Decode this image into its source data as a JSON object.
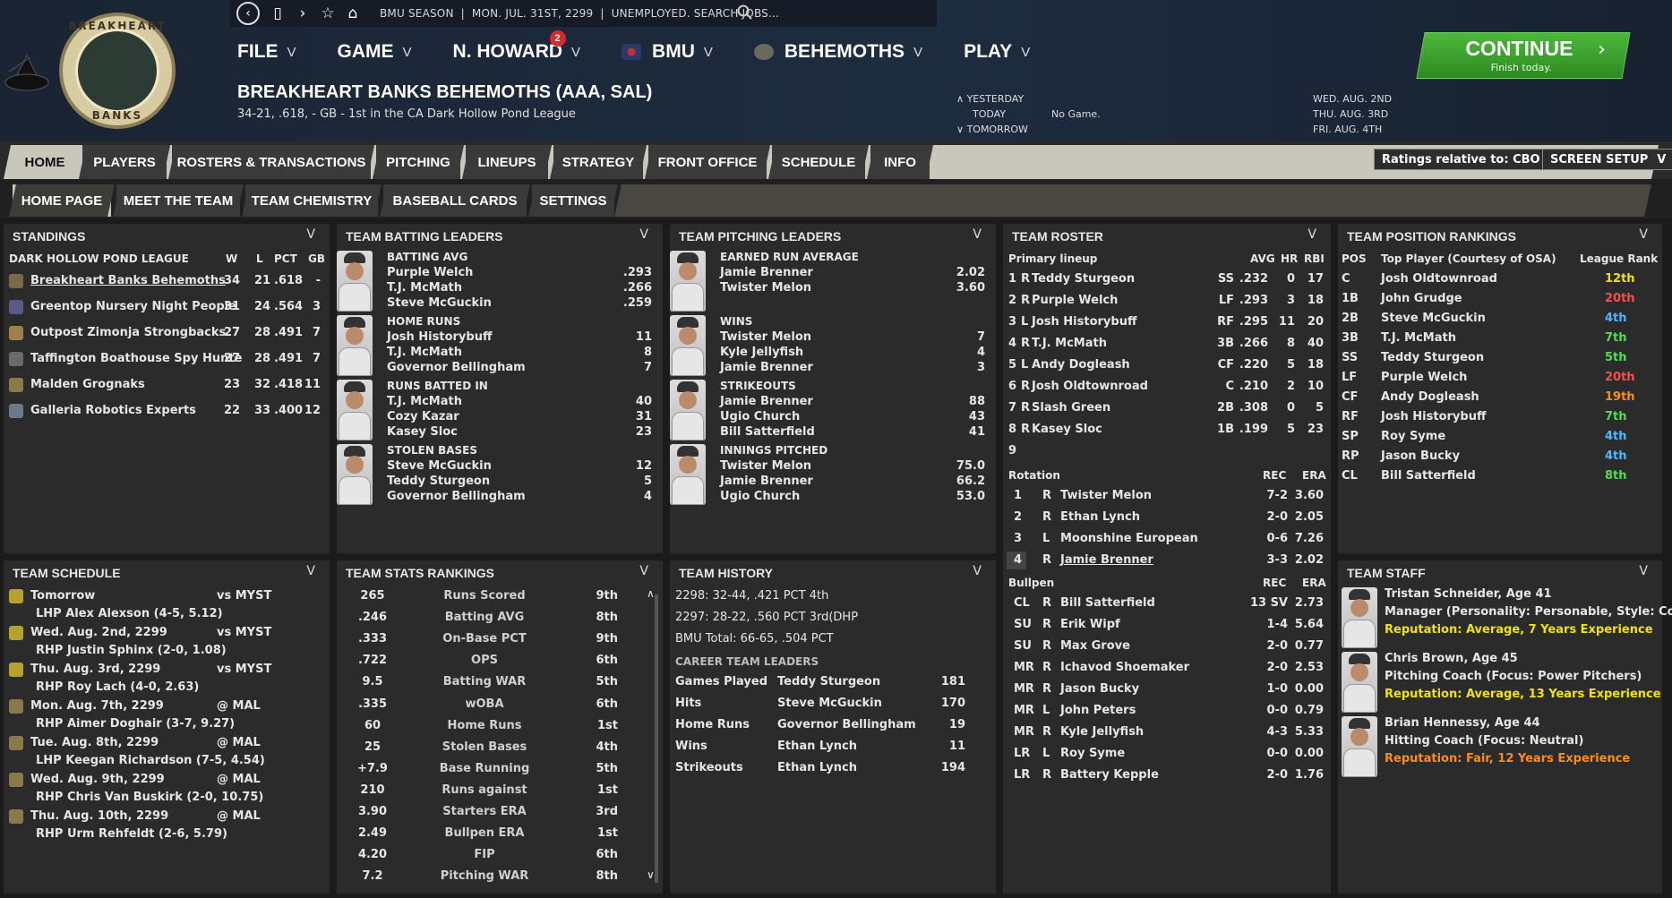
{
  "topbar": {
    "crumb": [
      "BMU SEASON",
      "|",
      "MON. JUL. 31ST, 2299",
      "|",
      "UNEMPLOYED. SEARCH JOBS..."
    ]
  },
  "logo": {
    "text_top": "BREAKHEART",
    "text_bottom": "BANKS"
  },
  "menu": [
    {
      "label": "FILE"
    },
    {
      "label": "GAME"
    },
    {
      "label": "N. HOWARD",
      "badge": "2"
    },
    {
      "label": "BMU"
    },
    {
      "label": "BEHEMOTHS"
    },
    {
      "label": "PLAY"
    }
  ],
  "team": {
    "name": "BREAKHEART BANKS BEHEMOTHS (AAA, SAL)",
    "sub": "34-21, .618, - GB - 1st in the CA Dark Hollow Pond League"
  },
  "daynav": {
    "yesterday": "YESTERDAY",
    "today": "TODAY",
    "today_note": "No Game.",
    "tomorrow": "TOMORROW",
    "dates": [
      "WED. AUG. 2ND",
      "THU. AUG. 3RD",
      "FRI. AUG. 4TH"
    ]
  },
  "continue": {
    "label": "CONTINUE",
    "sub": "Finish today."
  },
  "tabs": [
    "HOME",
    "PLAYERS",
    "ROSTERS & TRANSACTIONS",
    "PITCHING",
    "LINEUPS",
    "STRATEGY",
    "FRONT OFFICE",
    "SCHEDULE",
    "INFO"
  ],
  "subtabs": [
    "HOME PAGE",
    "MEET THE TEAM",
    "TEAM CHEMISTRY",
    "BASEBALL CARDS",
    "SETTINGS"
  ],
  "buttons": {
    "ratings": "Ratings relative to: CBO",
    "screen": "SCREEN SETUP"
  },
  "standings": {
    "title": "STANDINGS",
    "league": "DARK HOLLOW POND LEAGUE",
    "cols": [
      "W",
      "L",
      "PCT",
      "GB"
    ],
    "rows": [
      [
        "Breakheart Banks Behemoths",
        "34",
        "21",
        ".618",
        "-"
      ],
      [
        "Greentop Nursery Night People",
        "31",
        "24",
        ".564",
        "3"
      ],
      [
        "Outpost Zimonja Strongbacks",
        "27",
        "28",
        ".491",
        "7"
      ],
      [
        "Taffington Boathouse Spy Hunte",
        "27",
        "28",
        ".491",
        "7"
      ],
      [
        "Malden Grognaks",
        "23",
        "32",
        ".418",
        "11"
      ],
      [
        "Galleria Robotics Experts",
        "22",
        "33",
        ".400",
        "12"
      ]
    ]
  },
  "batting": {
    "title": "TEAM BATTING LEADERS",
    "groups": [
      {
        "cat": "BATTING AVG",
        "rows": [
          [
            "Purple Welch",
            ".293"
          ],
          [
            "T.J. McMath",
            ".266"
          ],
          [
            "Steve McGuckin",
            ".259"
          ]
        ]
      },
      {
        "cat": "HOME RUNS",
        "rows": [
          [
            "Josh Historybuff",
            "11"
          ],
          [
            "T.J. McMath",
            "8"
          ],
          [
            "Governor Bellingham",
            "7"
          ]
        ]
      },
      {
        "cat": "RUNS BATTED IN",
        "rows": [
          [
            "T.J. McMath",
            "40"
          ],
          [
            "Cozy Kazar",
            "31"
          ],
          [
            "Kasey Sloc",
            "23"
          ]
        ]
      },
      {
        "cat": "STOLEN BASES",
        "rows": [
          [
            "Steve McGuckin",
            "12"
          ],
          [
            "Teddy Sturgeon",
            "5"
          ],
          [
            "Governor Bellingham",
            "4"
          ]
        ]
      }
    ]
  },
  "pitching": {
    "title": "TEAM PITCHING LEADERS",
    "groups": [
      {
        "cat": "EARNED RUN AVERAGE",
        "rows": [
          [
            "Jamie Brenner",
            "2.02"
          ],
          [
            "Twister Melon",
            "3.60"
          ]
        ]
      },
      {
        "cat": "WINS",
        "rows": [
          [
            "Twister Melon",
            "7"
          ],
          [
            "Kyle Jellyfish",
            "4"
          ],
          [
            "Jamie Brenner",
            "3"
          ]
        ]
      },
      {
        "cat": "STRIKEOUTS",
        "rows": [
          [
            "Jamie Brenner",
            "88"
          ],
          [
            "Ugio Church",
            "43"
          ],
          [
            "Bill Satterfield",
            "41"
          ]
        ]
      },
      {
        "cat": "INNINGS PITCHED",
        "rows": [
          [
            "Twister Melon",
            "75.0"
          ],
          [
            "Jamie Brenner",
            "66.2"
          ],
          [
            "Ugio Church",
            "53.0"
          ]
        ]
      }
    ]
  },
  "roster": {
    "title": "TEAM ROSTER",
    "lineup_label": "Primary lineup",
    "cols": [
      "AVG",
      "HR",
      "RBI"
    ],
    "lineup": [
      [
        "1",
        "R",
        "Teddy Sturgeon",
        "SS",
        ".232",
        "0",
        "17"
      ],
      [
        "2",
        "R",
        "Purple Welch",
        "LF",
        ".293",
        "3",
        "18"
      ],
      [
        "3",
        "L",
        "Josh Historybuff",
        "RF",
        ".295",
        "11",
        "20"
      ],
      [
        "4",
        "R",
        "T.J. McMath",
        "3B",
        ".266",
        "8",
        "40"
      ],
      [
        "5",
        "L",
        "Andy Dogleash",
        "CF",
        ".220",
        "5",
        "18"
      ],
      [
        "6",
        "R",
        "Josh Oldtownroad",
        "C",
        ".210",
        "2",
        "10"
      ],
      [
        "7",
        "R",
        "Slash Green",
        "2B",
        ".308",
        "0",
        "5"
      ],
      [
        "8",
        "R",
        "Kasey Sloc",
        "1B",
        ".199",
        "5",
        "23"
      ],
      [
        "9",
        "",
        "",
        "",
        "",
        "",
        ""
      ]
    ],
    "rotation_label": "Rotation",
    "rec": "REC",
    "era": "ERA",
    "rotation": [
      [
        "1",
        "R",
        "Twister Melon",
        "7-2",
        "3.60"
      ],
      [
        "2",
        "R",
        "Ethan Lynch",
        "2-0",
        "2.05"
      ],
      [
        "3",
        "L",
        "Moonshine European",
        "0-6",
        "7.26"
      ],
      [
        "4",
        "R",
        "Jamie Brenner",
        "3-3",
        "2.02"
      ]
    ],
    "bullpen_label": "Bullpen",
    "bullpen": [
      [
        "CL",
        "R",
        "Bill Satterfield",
        "13 SV",
        "2.73"
      ],
      [
        "SU",
        "R",
        "Erik Wipf",
        "1-4",
        "5.64"
      ],
      [
        "SU",
        "R",
        "Max Grove",
        "2-0",
        "0.77"
      ],
      [
        "MR",
        "R",
        "Ichavod Shoemaker",
        "2-0",
        "2.53"
      ],
      [
        "MR",
        "R",
        "Jason Bucky",
        "1-0",
        "0.00"
      ],
      [
        "MR",
        "L",
        "John Peters",
        "0-0",
        "0.79"
      ],
      [
        "MR",
        "R",
        "Kyle Jellyfish",
        "4-3",
        "5.33"
      ],
      [
        "LR",
        "L",
        "Roy Syme",
        "0-0",
        "0.00"
      ],
      [
        "LR",
        "R",
        "Battery Kepple",
        "2-0",
        "1.76"
      ]
    ]
  },
  "positions": {
    "title": "TEAM POSITION RANKINGS",
    "cols": [
      "POS",
      "Top Player (Courtesy of OSA)",
      "League Rank"
    ],
    "rows": [
      [
        "C",
        "Josh Oldtownroad",
        "12th",
        "#f2e300"
      ],
      [
        "1B",
        "John Grudge",
        "20th",
        "#ff4c4c"
      ],
      [
        "2B",
        "Steve McGuckin",
        "4th",
        "#4cb7ff"
      ],
      [
        "3B",
        "T.J. McMath",
        "7th",
        "#4ee04e"
      ],
      [
        "SS",
        "Teddy Sturgeon",
        "5th",
        "#4ee04e"
      ],
      [
        "LF",
        "Purple Welch",
        "20th",
        "#ff4c4c"
      ],
      [
        "CF",
        "Andy Dogleash",
        "19th",
        "#ff8c1a"
      ],
      [
        "RF",
        "Josh Historybuff",
        "7th",
        "#4ee04e"
      ],
      [
        "SP",
        "Roy Syme",
        "4th",
        "#4cb7ff"
      ],
      [
        "RP",
        "Jason Bucky",
        "4th",
        "#4cb7ff"
      ],
      [
        "CL",
        "Bill Satterfield",
        "8th",
        "#4ee04e"
      ]
    ]
  },
  "schedule": {
    "title": "TEAM SCHEDULE",
    "rows": [
      [
        "Tomorrow",
        "vs MYST",
        "LHP Alex Alexson (4-5, 5.12)"
      ],
      [
        "Wed. Aug. 2nd, 2299",
        "vs MYST",
        "RHP Justin Sphinx (2-0, 1.08)"
      ],
      [
        "Thu. Aug. 3rd, 2299",
        "vs MYST",
        "RHP Roy Lach (4-0, 2.63)"
      ],
      [
        "Mon. Aug. 7th, 2299",
        "@ MAL",
        "RHP Aimer Doghair (3-7, 9.27)"
      ],
      [
        "Tue. Aug. 8th, 2299",
        "@ MAL",
        "LHP Keegan Richardson (7-5, 4.54)"
      ],
      [
        "Wed. Aug. 9th, 2299",
        "@ MAL",
        "RHP Chris Van Buskirk (2-0, 10.75)"
      ],
      [
        "Thu. Aug. 10th, 2299",
        "@ MAL",
        "RHP Urm Rehfeldt (2-6, 5.79)"
      ]
    ]
  },
  "stats": {
    "title": "TEAM STATS RANKINGS",
    "rows": [
      [
        "265",
        "Runs Scored",
        "9th"
      ],
      [
        ".246",
        "Batting AVG",
        "8th"
      ],
      [
        ".333",
        "On-Base PCT",
        "9th"
      ],
      [
        ".722",
        "OPS",
        "6th"
      ],
      [
        "9.5",
        "Batting WAR",
        "5th"
      ],
      [
        ".335",
        "wOBA",
        "6th"
      ],
      [
        "60",
        "Home Runs",
        "1st"
      ],
      [
        "25",
        "Stolen Bases",
        "4th"
      ],
      [
        "+7.9",
        "Base Running",
        "5th"
      ],
      [
        "210",
        "Runs against",
        "1st"
      ],
      [
        "3.90",
        "Starters ERA",
        "3rd"
      ],
      [
        "2.49",
        "Bullpen ERA",
        "1st"
      ],
      [
        "4.20",
        "FIP",
        "6th"
      ],
      [
        "7.2",
        "Pitching WAR",
        "8th"
      ]
    ]
  },
  "history": {
    "title": "TEAM HISTORY",
    "lines": [
      "2298: 32-44, .421 PCT 4th",
      "2297: 28-22, .560 PCT 3rd(DHP",
      "BMU Total: 66-65, .504 PCT"
    ],
    "career_label": "CAREER TEAM LEADERS",
    "career": [
      [
        "Games Played",
        "Teddy Sturgeon",
        "181"
      ],
      [
        "Hits",
        "Steve McGuckin",
        "170"
      ],
      [
        "Home Runs",
        "Governor Bellingham",
        "19"
      ],
      [
        "Wins",
        "Ethan Lynch",
        "11"
      ],
      [
        "Strikeouts",
        "Ethan Lynch",
        "194"
      ]
    ]
  },
  "staff": {
    "title": "TEAM STAFF",
    "rows": [
      {
        "name": "Tristan Schneider, Age 41",
        "role": "Manager (Personality: Personable, Style: Conventi",
        "rep": "Reputation: Average, 7 Years Experience",
        "rep_color": "#f2e300"
      },
      {
        "name": "Chris Brown, Age 45",
        "role": "Pitching Coach (Focus: Power Pitchers)",
        "rep": "Reputation: Average, 13 Years Experience",
        "rep_color": "#f2e300"
      },
      {
        "name": "Brian Hennessy, Age 44",
        "role": "Hitting Coach (Focus: Neutral)",
        "rep": "Reputation: Fair, 12 Years Experience",
        "rep_color": "#ff8c1a"
      }
    ]
  },
  "colors": {
    "accent_green": "#3aa52c",
    "header_bg": "#1e2c40",
    "panel_bg": "#2b2b2b"
  }
}
